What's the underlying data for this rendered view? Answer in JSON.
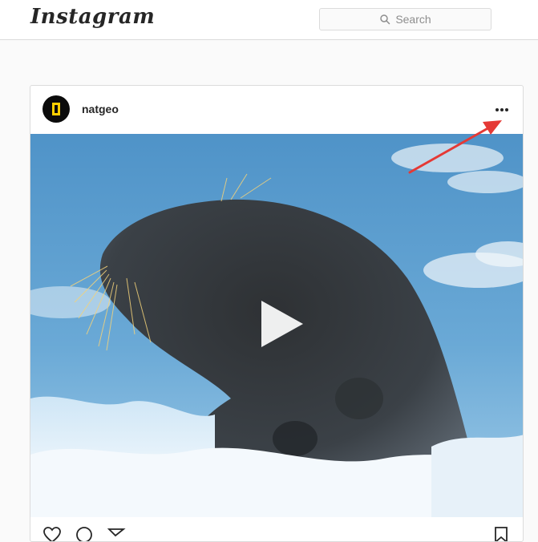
{
  "app": {
    "logo_text": "Instagram",
    "search_placeholder": "Search"
  },
  "post": {
    "username": "natgeo",
    "more_options_label": "...",
    "media_type": "video",
    "play_icon": "play-icon"
  },
  "icons": {
    "search": "search-icon",
    "more": "more-options-icon",
    "like": "heart-icon",
    "comment": "comment-icon",
    "share": "share-icon",
    "save": "bookmark-icon"
  },
  "colors": {
    "border": "#dbdbdb",
    "text": "#262626",
    "muted": "#8e8e8e",
    "annotation_arrow": "#e53935",
    "brand_yellow": "#ffce00"
  }
}
